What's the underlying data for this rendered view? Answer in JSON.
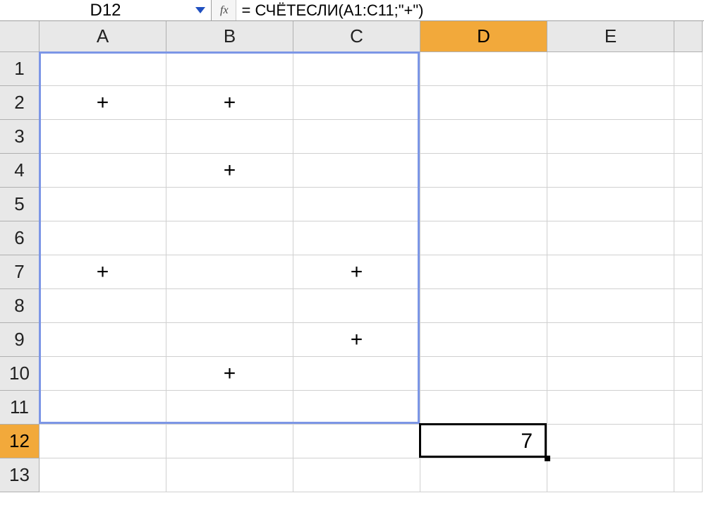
{
  "name_box": "D12",
  "fx_label": "fx",
  "formula": "= СЧЁТЕСЛИ(A1:C11;\"+\")",
  "columns": [
    "A",
    "B",
    "C",
    "D",
    "E"
  ],
  "rows": [
    "1",
    "2",
    "3",
    "4",
    "5",
    "6",
    "7",
    "8",
    "9",
    "10",
    "11",
    "12",
    "13"
  ],
  "selected_col": "D",
  "selected_row": "12",
  "cells": {
    "A2": "+",
    "B2": "+",
    "B4": "+",
    "A7": "+",
    "C7": "+",
    "C9": "+",
    "B10": "+",
    "D12": "7"
  },
  "range_highlight": {
    "start_col": "A",
    "end_col": "C",
    "start_row": "1",
    "end_row": "11"
  },
  "active_cell": "D12",
  "chart_data": {
    "type": "table",
    "title": "COUNTIF of '+' in range A1:C11",
    "formula": "=СЧЁТЕСЛИ(A1:C11;\"+\")",
    "result": 7,
    "grid": [
      [
        "",
        "",
        ""
      ],
      [
        "+",
        "+",
        ""
      ],
      [
        "",
        "",
        ""
      ],
      [
        "",
        "+",
        ""
      ],
      [
        "",
        "",
        ""
      ],
      [
        "",
        "",
        ""
      ],
      [
        "+",
        "",
        "+"
      ],
      [
        "",
        "",
        ""
      ],
      [
        "",
        "",
        "+"
      ],
      [
        "",
        "+",
        ""
      ],
      [
        "",
        "",
        ""
      ]
    ]
  }
}
